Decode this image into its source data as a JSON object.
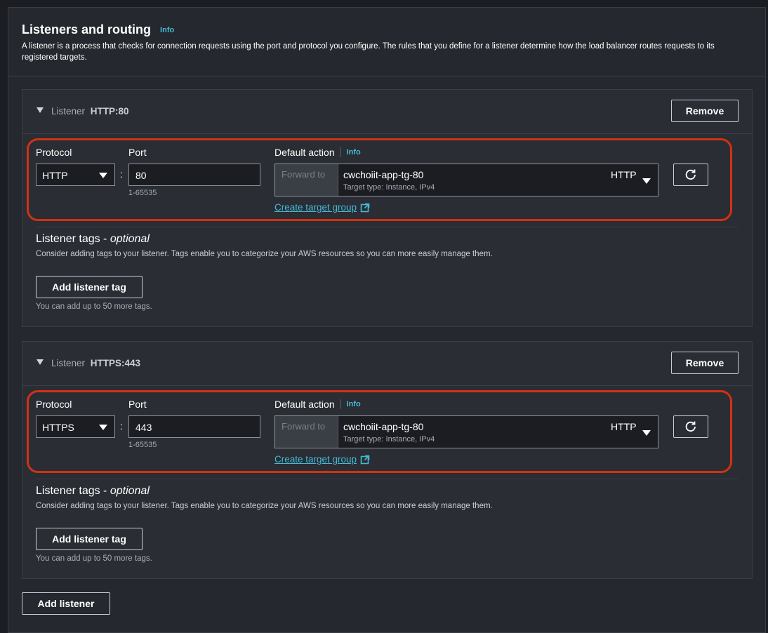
{
  "header": {
    "title": "Listeners and routing",
    "info": "Info",
    "description": "A listener is a process that checks for connection requests using the port and protocol you configure. The rules that you define for a listener determine how the load balancer routes requests to its registered targets."
  },
  "listeners": [
    {
      "prefix": "Listener",
      "name": "HTTP:80",
      "remove_label": "Remove",
      "protocol_label": "Protocol",
      "protocol_value": "HTTP",
      "colon": ":",
      "port_label": "Port",
      "port_value": "80",
      "port_hint": "1-65535",
      "default_action_label": "Default action",
      "default_action_info": "Info",
      "forward_to": "Forward to",
      "target_group": "cwchoiit-app-tg-80",
      "target_type": "Target type: Instance, IPv4",
      "target_protocol": "HTTP",
      "create_target_group": "Create target group",
      "tags_title": "Listener tags - ",
      "tags_optional": "optional",
      "tags_description": "Consider adding tags to your listener. Tags enable you to categorize your AWS resources so you can more easily manage them.",
      "add_tag_label": "Add listener tag",
      "tags_hint": "You can add up to 50 more tags."
    },
    {
      "prefix": "Listener",
      "name": "HTTPS:443",
      "remove_label": "Remove",
      "protocol_label": "Protocol",
      "protocol_value": "HTTPS",
      "colon": ":",
      "port_label": "Port",
      "port_value": "443",
      "port_hint": "1-65535",
      "default_action_label": "Default action",
      "default_action_info": "Info",
      "forward_to": "Forward to",
      "target_group": "cwchoiit-app-tg-80",
      "target_type": "Target type: Instance, IPv4",
      "target_protocol": "HTTP",
      "create_target_group": "Create target group",
      "tags_title": "Listener tags - ",
      "tags_optional": "optional",
      "tags_description": "Consider adding tags to your listener. Tags enable you to categorize your AWS resources so you can more easily manage them.",
      "add_tag_label": "Add listener tag",
      "tags_hint": "You can add up to 50 more tags."
    }
  ],
  "add_listener_label": "Add listener",
  "icons": {
    "expand": "caret-down-icon",
    "dropdown": "chevron-down-icon",
    "refresh": "refresh-icon",
    "external": "external-link-icon"
  },
  "colors": {
    "link": "#44b9d6",
    "highlight": "#d13212",
    "background": "#25282e"
  }
}
